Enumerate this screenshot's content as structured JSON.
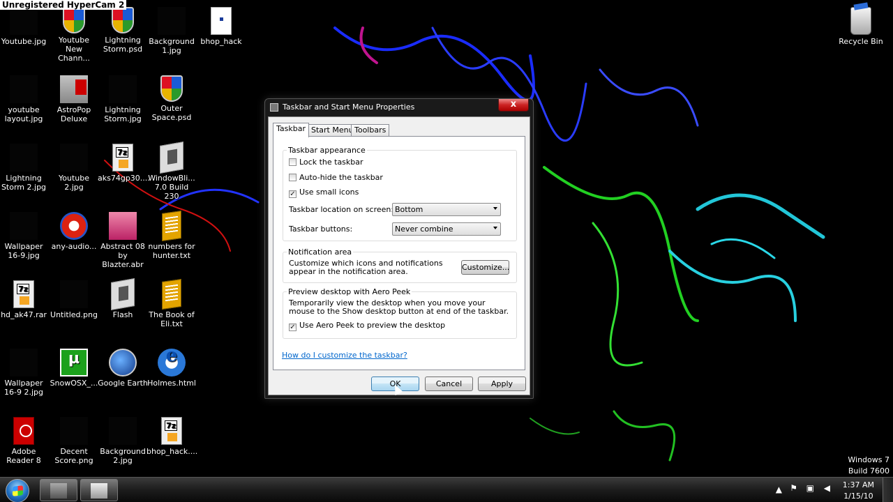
{
  "watermark": "Unregistered HyperCam 2",
  "desktop_icons": [
    {
      "label": "Youtube.jpg",
      "icon": "image-thumbnail-icon"
    },
    {
      "label": "Youtube\nNew Chann...",
      "icon": "windows-shield-icon"
    },
    {
      "label": "Lightning\nStorm.psd",
      "icon": "windows-shield-icon"
    },
    {
      "label": "Background\n1.jpg",
      "icon": "image-thumbnail-icon"
    },
    {
      "label": "bhop_hack",
      "icon": "roblox-file-icon"
    },
    {
      "label": "youtube\nlayout.jpg",
      "icon": "image-thumbnail-icon"
    },
    {
      "label": "AstroPop\nDeluxe",
      "icon": "astropop-icon"
    },
    {
      "label": "Lightning\nStorm.jpg",
      "icon": "image-thumbnail-icon"
    },
    {
      "label": "Outer\nSpace.psd",
      "icon": "windows-shield-icon"
    },
    {
      "label": "Lightning\nStorm 2.jpg",
      "icon": "image-thumbnail-icon"
    },
    {
      "label": "Youtube\n2.jpg",
      "icon": "image-thumbnail-icon"
    },
    {
      "label": "aks74gp30....",
      "icon": "7z-archive-icon"
    },
    {
      "label": "WindowBli...\n7.0 Build 230",
      "icon": "installer-icon"
    },
    {
      "label": "Wallpaper\n16-9.jpg",
      "icon": "image-thumbnail-icon"
    },
    {
      "label": "any-audio...",
      "icon": "audio-converter-icon"
    },
    {
      "label": "Abstract 08\nby Blazter.abr",
      "icon": "brush-file-icon"
    },
    {
      "label": "numbers for\nhunter.txt",
      "icon": "text-file-icon"
    },
    {
      "label": "hd_ak47.rar",
      "icon": "7z-archive-icon"
    },
    {
      "label": "Untitled.png",
      "icon": "image-thumbnail-icon"
    },
    {
      "label": "Flash",
      "icon": "flash-installer-icon"
    },
    {
      "label": "The Book of\nEli.txt",
      "icon": "text-file-icon"
    },
    {
      "label": "Wallpaper\n16-9 2.jpg",
      "icon": "image-thumbnail-icon"
    },
    {
      "label": "SnowOSX_...",
      "icon": "utorrent-icon"
    },
    {
      "label": "Google Earth",
      "icon": "google-earth-icon"
    },
    {
      "label": "Holmes.html",
      "icon": "internet-explorer-icon"
    },
    {
      "label": "Adobe\nReader 8",
      "icon": "adobe-reader-icon"
    },
    {
      "label": "Decent\nScore.png",
      "icon": "image-thumbnail-icon"
    },
    {
      "label": "Background\n2.jpg",
      "icon": "image-thumbnail-icon"
    },
    {
      "label": "bhop_hack....",
      "icon": "7z-archive-icon"
    },
    {
      "label": "Recycle Bin",
      "icon": "recycle-bin-icon"
    }
  ],
  "dialog": {
    "title": "Taskbar and Start Menu Properties",
    "close": "x",
    "tabs": [
      "Taskbar",
      "Start Menu",
      "Toolbars"
    ],
    "appearance": {
      "title": "Taskbar appearance",
      "lock": {
        "label": "Lock the taskbar",
        "checked": false
      },
      "autohide": {
        "label": "Auto-hide the taskbar",
        "checked": false
      },
      "small_icons": {
        "label": "Use small icons",
        "checked": true
      },
      "location_label": "Taskbar location on screen:",
      "location_value": "Bottom",
      "buttons_label": "Taskbar buttons:",
      "buttons_value": "Never combine"
    },
    "notification": {
      "title": "Notification area",
      "text": "Customize which icons and notifications appear in the notification area.",
      "button": "Customize..."
    },
    "peek": {
      "title": "Preview desktop with Aero Peek",
      "text": "Temporarily view the desktop when you move your mouse to the Show desktop button at end of the taskbar.",
      "checkbox": {
        "label": "Use Aero Peek to preview the desktop",
        "checked": true
      }
    },
    "help_link": "How do I customize the taskbar?",
    "ok": "OK",
    "cancel": "Cancel",
    "apply": "Apply"
  },
  "watermark_os": {
    "line1": "Windows 7",
    "line2": "Build 7600"
  },
  "taskbar": {
    "time": "1:37 AM",
    "date": "1/15/10"
  },
  "colors": {
    "link": "#0066cc",
    "accent": "#3c7fb1"
  }
}
